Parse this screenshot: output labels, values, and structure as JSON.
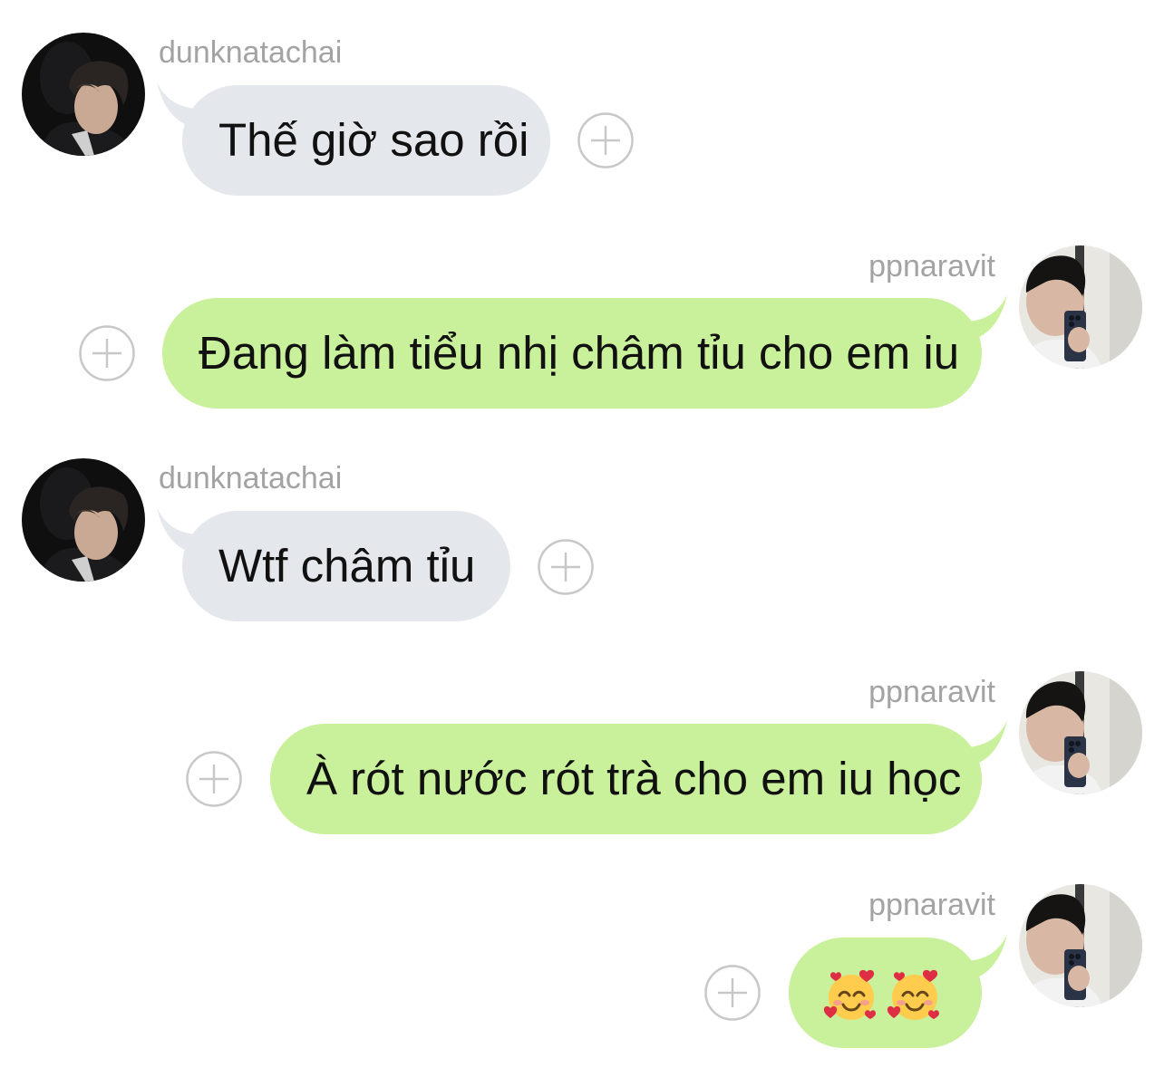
{
  "conversation": {
    "messages": [
      {
        "sender": "dunknatachai",
        "direction": "incoming",
        "text": "Thế giờ sao rồi",
        "avatar_icon": "contact-photo-dunknatachai",
        "action_icon": "add-reaction-icon"
      },
      {
        "sender": "ppnaravit",
        "direction": "outgoing",
        "text": "Đang làm tiểu nhị châm tỉu cho em iu",
        "avatar_icon": "contact-photo-ppnaravit",
        "action_icon": "add-reaction-icon"
      },
      {
        "sender": "dunknatachai",
        "direction": "incoming",
        "text": "Wtf châm tỉu",
        "avatar_icon": "contact-photo-dunknatachai",
        "action_icon": "add-reaction-icon"
      },
      {
        "sender": "ppnaravit",
        "direction": "outgoing",
        "text": "À rót nước rót trà cho em iu học",
        "avatar_icon": "contact-photo-ppnaravit",
        "action_icon": "add-reaction-icon"
      },
      {
        "sender": "ppnaravit",
        "direction": "outgoing",
        "text": "",
        "emojis": [
          "smiling-face-with-hearts-emoji",
          "smiling-face-with-hearts-emoji"
        ],
        "avatar_icon": "contact-photo-ppnaravit",
        "action_icon": "add-reaction-icon"
      }
    ]
  },
  "colors": {
    "background": "#ffffff",
    "incoming_bubble": "#e4e8ec",
    "outgoing_bubble": "#c9f09a",
    "username_text": "#a3a3a3",
    "message_text": "#111111",
    "plus_icon": "#c8c8c8"
  }
}
